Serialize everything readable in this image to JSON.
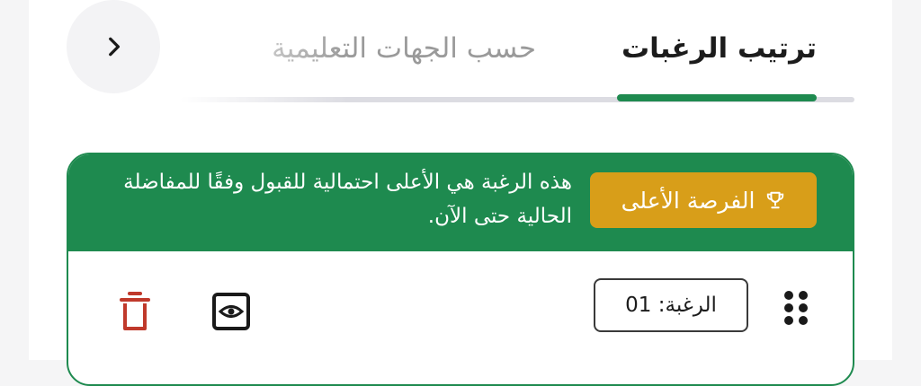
{
  "header": {
    "back_icon": "chevron-right-icon",
    "tabs": [
      {
        "label": "ترتيب الرغبات",
        "active": true
      },
      {
        "label": "حسب الجهات التعليمية",
        "active": false
      }
    ]
  },
  "highlight": {
    "badge_label": "الفرصة الأعلى",
    "badge_icon": "trophy-icon",
    "message": "هذه الرغبة هي الأعلى احتمالية للقبول وفقًا للمفاضلة الحالية حتى الآن.",
    "colors": {
      "accent": "#1e8a4f",
      "badge": "#d89e19",
      "delete": "#c0392b"
    }
  },
  "wish_row": {
    "label": "الرغبة: 01",
    "drag_icon": "drag-handle-icon",
    "view_icon": "eye-icon",
    "delete_icon": "trash-icon"
  }
}
